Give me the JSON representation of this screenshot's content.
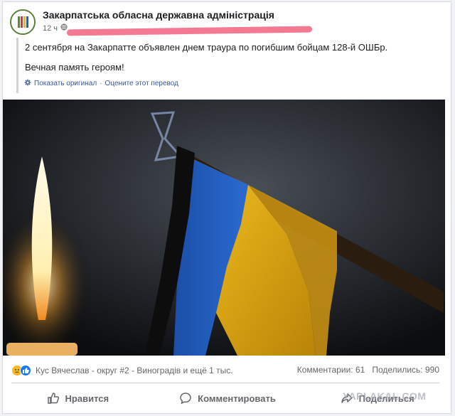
{
  "post": {
    "page_name": "Закарпатська обласна державна адміністрація",
    "time": "12 ч",
    "translated_line1": "2 сентября на Закарпатте объявлен днем траура по погибшим бойцам 128-й ОШБр.",
    "translated_line2": "Вечная память героям!",
    "show_original": "Показать оригинал",
    "separator": "·",
    "rate_translation": "Оцените этот перевод"
  },
  "reactions": {
    "names": "Кус Вячеслав - округ #2 - Виноградів и ещё 1 тыс.",
    "comments": "Комментарии: 61",
    "shares": "Поделились: 990"
  },
  "actions": {
    "like": "Нравится",
    "comment": "Комментировать",
    "share": "Поделиться"
  },
  "watermark": "YAPLAKAL.COM",
  "colors": {
    "flag_blue": "#1f5fbf",
    "flag_yellow": "#e8b818",
    "mourning_ribbon": "#0d0d0d",
    "highlight_scribble": "#f36a86"
  }
}
